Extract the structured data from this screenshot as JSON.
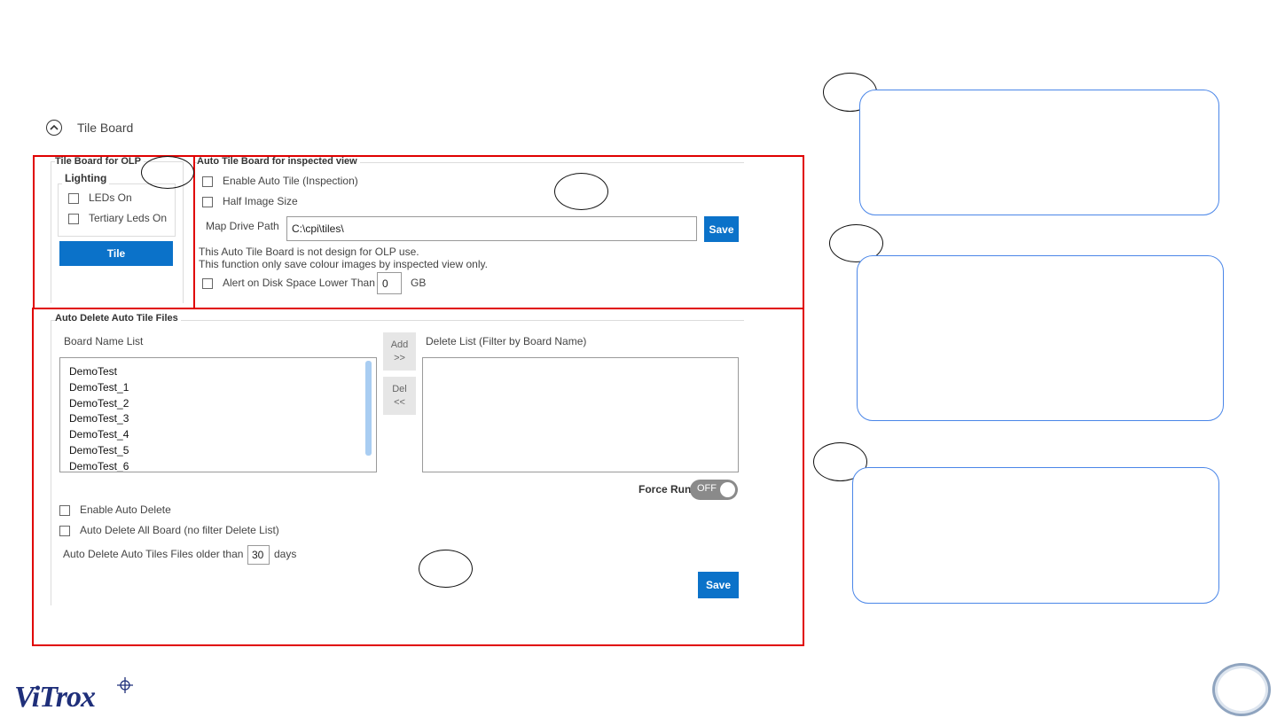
{
  "section": {
    "title": "Tile Board"
  },
  "tile_board_olp": {
    "title": "Tile Board for OLP",
    "lighting_label": "Lighting",
    "leds_on": "LEDs On",
    "tertiary_leds_on": "Tertiary Leds On",
    "tile_button": "Tile"
  },
  "auto_tile": {
    "title": "Auto Tile Board for inspected view",
    "enable_auto_tile": "Enable Auto Tile (Inspection)",
    "half_image_size": "Half Image Size",
    "map_drive_path_label": "Map Drive Path",
    "map_drive_path_value": "C:\\cpi\\tiles\\",
    "save_button": "Save",
    "note_line1": "This Auto Tile Board is not design for OLP use.",
    "note_line2": "This function only save colour images by inspected view only.",
    "alert_disk_label": "Alert on Disk Space Lower Than",
    "alert_disk_value": "0",
    "alert_disk_unit": "GB"
  },
  "auto_delete": {
    "title": "Auto Delete Auto Tile Files",
    "board_name_list_label": "Board Name List",
    "board_names": [
      "DemoTest",
      "DemoTest_1",
      "DemoTest_2",
      "DemoTest_3",
      "DemoTest_4",
      "DemoTest_5",
      "DemoTest_6"
    ],
    "add_button_line1": "Add",
    "add_button_line2": ">>",
    "del_button_line1": "Del",
    "del_button_line2": "<<",
    "delete_list_label": "Delete List (Filter by Board Name)",
    "force_run_label": "Force Run",
    "force_run_state": "OFF",
    "enable_auto_delete": "Enable Auto Delete",
    "auto_delete_all": "Auto Delete All Board (no filter Delete List)",
    "older_than_label": "Auto Delete Auto Tiles Files older than",
    "older_than_value": "30",
    "older_than_unit": "days",
    "save_button": "Save"
  },
  "logo": {
    "text": "ViTrox"
  },
  "colors": {
    "highlight_red": "#e00000",
    "callout_blue": "#4a86e8",
    "button_blue": "#0b72c9"
  }
}
